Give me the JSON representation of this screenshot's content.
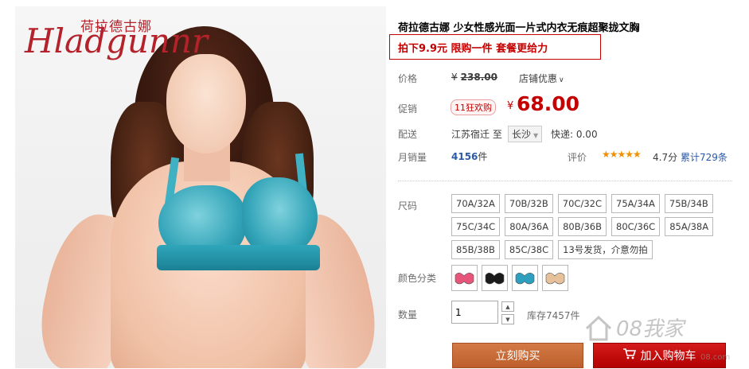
{
  "image": {
    "brand_cn": "荷拉德古娜",
    "brand_en": "Hladgunnr"
  },
  "product": {
    "title": "荷拉德古娜 少女性感光面一片式内衣无痕超聚拢文胸",
    "promo": "拍下9.9元 限购一件 套餐更给力"
  },
  "price_row": {
    "label": "价格",
    "currency": "¥",
    "original": "238.00",
    "store_discount": "店铺优惠",
    "chevron": "chevron-down-icon"
  },
  "promo_row": {
    "label": "促销",
    "badge": "11狂欢购",
    "currency": "¥",
    "price": "68.00"
  },
  "shipping": {
    "label": "配送",
    "from": "江苏宿迁",
    "to_prefix": "至",
    "to": "长沙",
    "express": "快递: 0.00"
  },
  "sales": {
    "label": "月销量",
    "count": "4156",
    "unit": "件",
    "rating_label": "评价",
    "stars": "★★★★★",
    "score": "4.7分",
    "reviews": "累计729条"
  },
  "sizes": {
    "label": "尺码",
    "options": [
      "70A/32A",
      "70B/32B",
      "70C/32C",
      "75A/34A",
      "75B/34B",
      "75C/34C",
      "80A/36A",
      "80B/36B",
      "80C/36C",
      "85A/38A",
      "85B/38B",
      "85C/38C",
      "13号发货，介意勿拍"
    ]
  },
  "colors": {
    "label": "颜色分类",
    "swatches": [
      "#e8557a",
      "#1a1a1a",
      "#2e9fbf",
      "#e6c19a"
    ]
  },
  "quantity": {
    "label": "数量",
    "value": "1",
    "stock": "库存7457件"
  },
  "actions": {
    "buy_now": "立刻购买",
    "add_to_cart": "加入购物车",
    "cart_icon": "cart-icon"
  },
  "watermark": {
    "text": "08我家",
    "sub": "08.com"
  },
  "accent": {
    "red": "#c40000",
    "orange": "#c76b37",
    "link": "#2b5aa6"
  }
}
